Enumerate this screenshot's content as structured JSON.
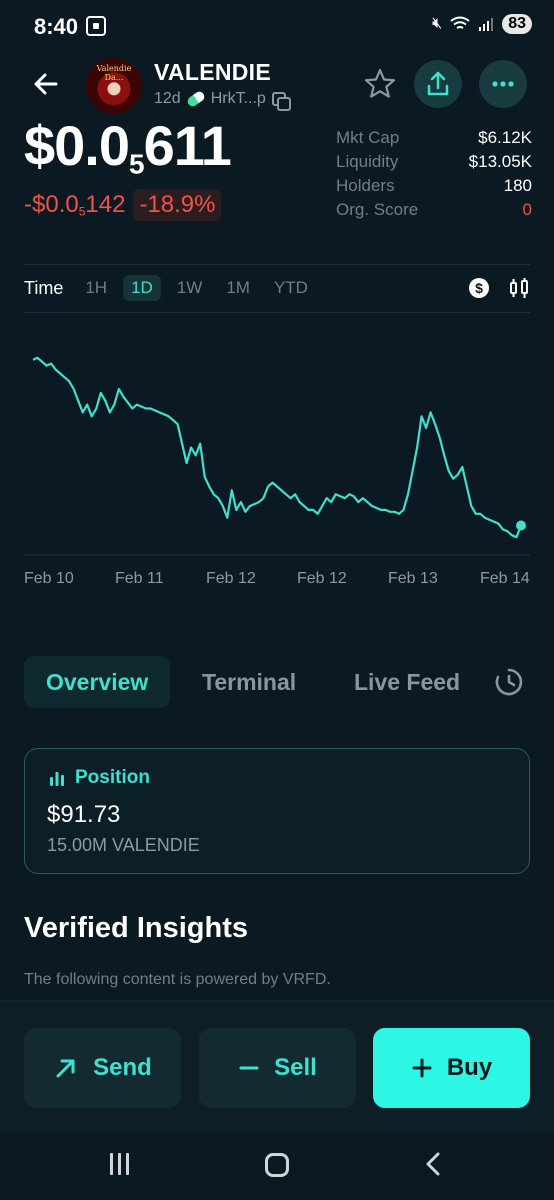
{
  "status_bar": {
    "time": "8:40",
    "battery": "83",
    "icons": [
      "screenshot-icon",
      "mute-icon",
      "wifi-icon",
      "signal-icon",
      "battery-icon"
    ]
  },
  "header": {
    "avatar_text": "Valendie Da...",
    "token_name": "VALENDIE",
    "age": "12d",
    "address": "HrkT...p"
  },
  "price": {
    "main_prefix": "$0.0",
    "main_sub": "5",
    "main_suffix": "611",
    "change_prefix": "-$0.0",
    "change_sub": "5",
    "change_suffix": "142",
    "change_pct": "-18.9%"
  },
  "stats": [
    {
      "label": "Mkt Cap",
      "value": "$6.12K"
    },
    {
      "label": "Liquidity",
      "value": "$13.05K"
    },
    {
      "label": "Holders",
      "value": "180"
    },
    {
      "label": "Org. Score",
      "value": "0",
      "color": "#f0524a"
    }
  ],
  "timeframe": {
    "label": "Time",
    "options": [
      "1H",
      "1D",
      "1W",
      "1M",
      "YTD"
    ],
    "selected": "1D"
  },
  "chart_data": {
    "type": "line",
    "x_tick_labels": [
      "Feb 10",
      "Feb 11",
      "Feb 12",
      "Feb 12",
      "Feb 13",
      "Feb 14"
    ],
    "series": [
      {
        "color": "#3fe0cf",
        "values": [
          0.95,
          0.96,
          0.94,
          0.92,
          0.93,
          0.9,
          0.88,
          0.86,
          0.84,
          0.8,
          0.74,
          0.68,
          0.72,
          0.66,
          0.7,
          0.78,
          0.74,
          0.68,
          0.72,
          0.8,
          0.76,
          0.73,
          0.7,
          0.72,
          0.71,
          0.7,
          0.7,
          0.69,
          0.68,
          0.67,
          0.66,
          0.64,
          0.62,
          0.52,
          0.42,
          0.5,
          0.46,
          0.52,
          0.35,
          0.3,
          0.26,
          0.24,
          0.2,
          0.14,
          0.28,
          0.18,
          0.22,
          0.17,
          0.2,
          0.21,
          0.22,
          0.24,
          0.3,
          0.32,
          0.3,
          0.28,
          0.26,
          0.24,
          0.26,
          0.22,
          0.2,
          0.18,
          0.18,
          0.16,
          0.2,
          0.24,
          0.22,
          0.26,
          0.25,
          0.24,
          0.26,
          0.25,
          0.22,
          0.24,
          0.22,
          0.2,
          0.19,
          0.18,
          0.18,
          0.17,
          0.17,
          0.16,
          0.18,
          0.26,
          0.38,
          0.5,
          0.66,
          0.6,
          0.68,
          0.62,
          0.55,
          0.46,
          0.38,
          0.34,
          0.36,
          0.4,
          0.3,
          0.2,
          0.16,
          0.16,
          0.14,
          0.13,
          0.12,
          0.11,
          0.08,
          0.07,
          0.05,
          0.04,
          0.1
        ]
      }
    ],
    "grid": false
  },
  "tabs": [
    {
      "label": "Overview",
      "active": true
    },
    {
      "label": "Terminal",
      "active": false
    },
    {
      "label": "Live Feed",
      "active": false
    }
  ],
  "position": {
    "title": "Position",
    "value": "$91.73",
    "amount": "15.00M VALENDIE"
  },
  "insights": {
    "title": "Verified Insights",
    "subtitle": "The following content is powered by VRFD."
  },
  "actions": {
    "send": "Send",
    "sell": "Sell",
    "buy": "Buy"
  },
  "colors": {
    "accent": "#3fe0cf",
    "negative": "#f0524a",
    "background": "#0b1a22",
    "buy_button": "#2ef6e4"
  }
}
